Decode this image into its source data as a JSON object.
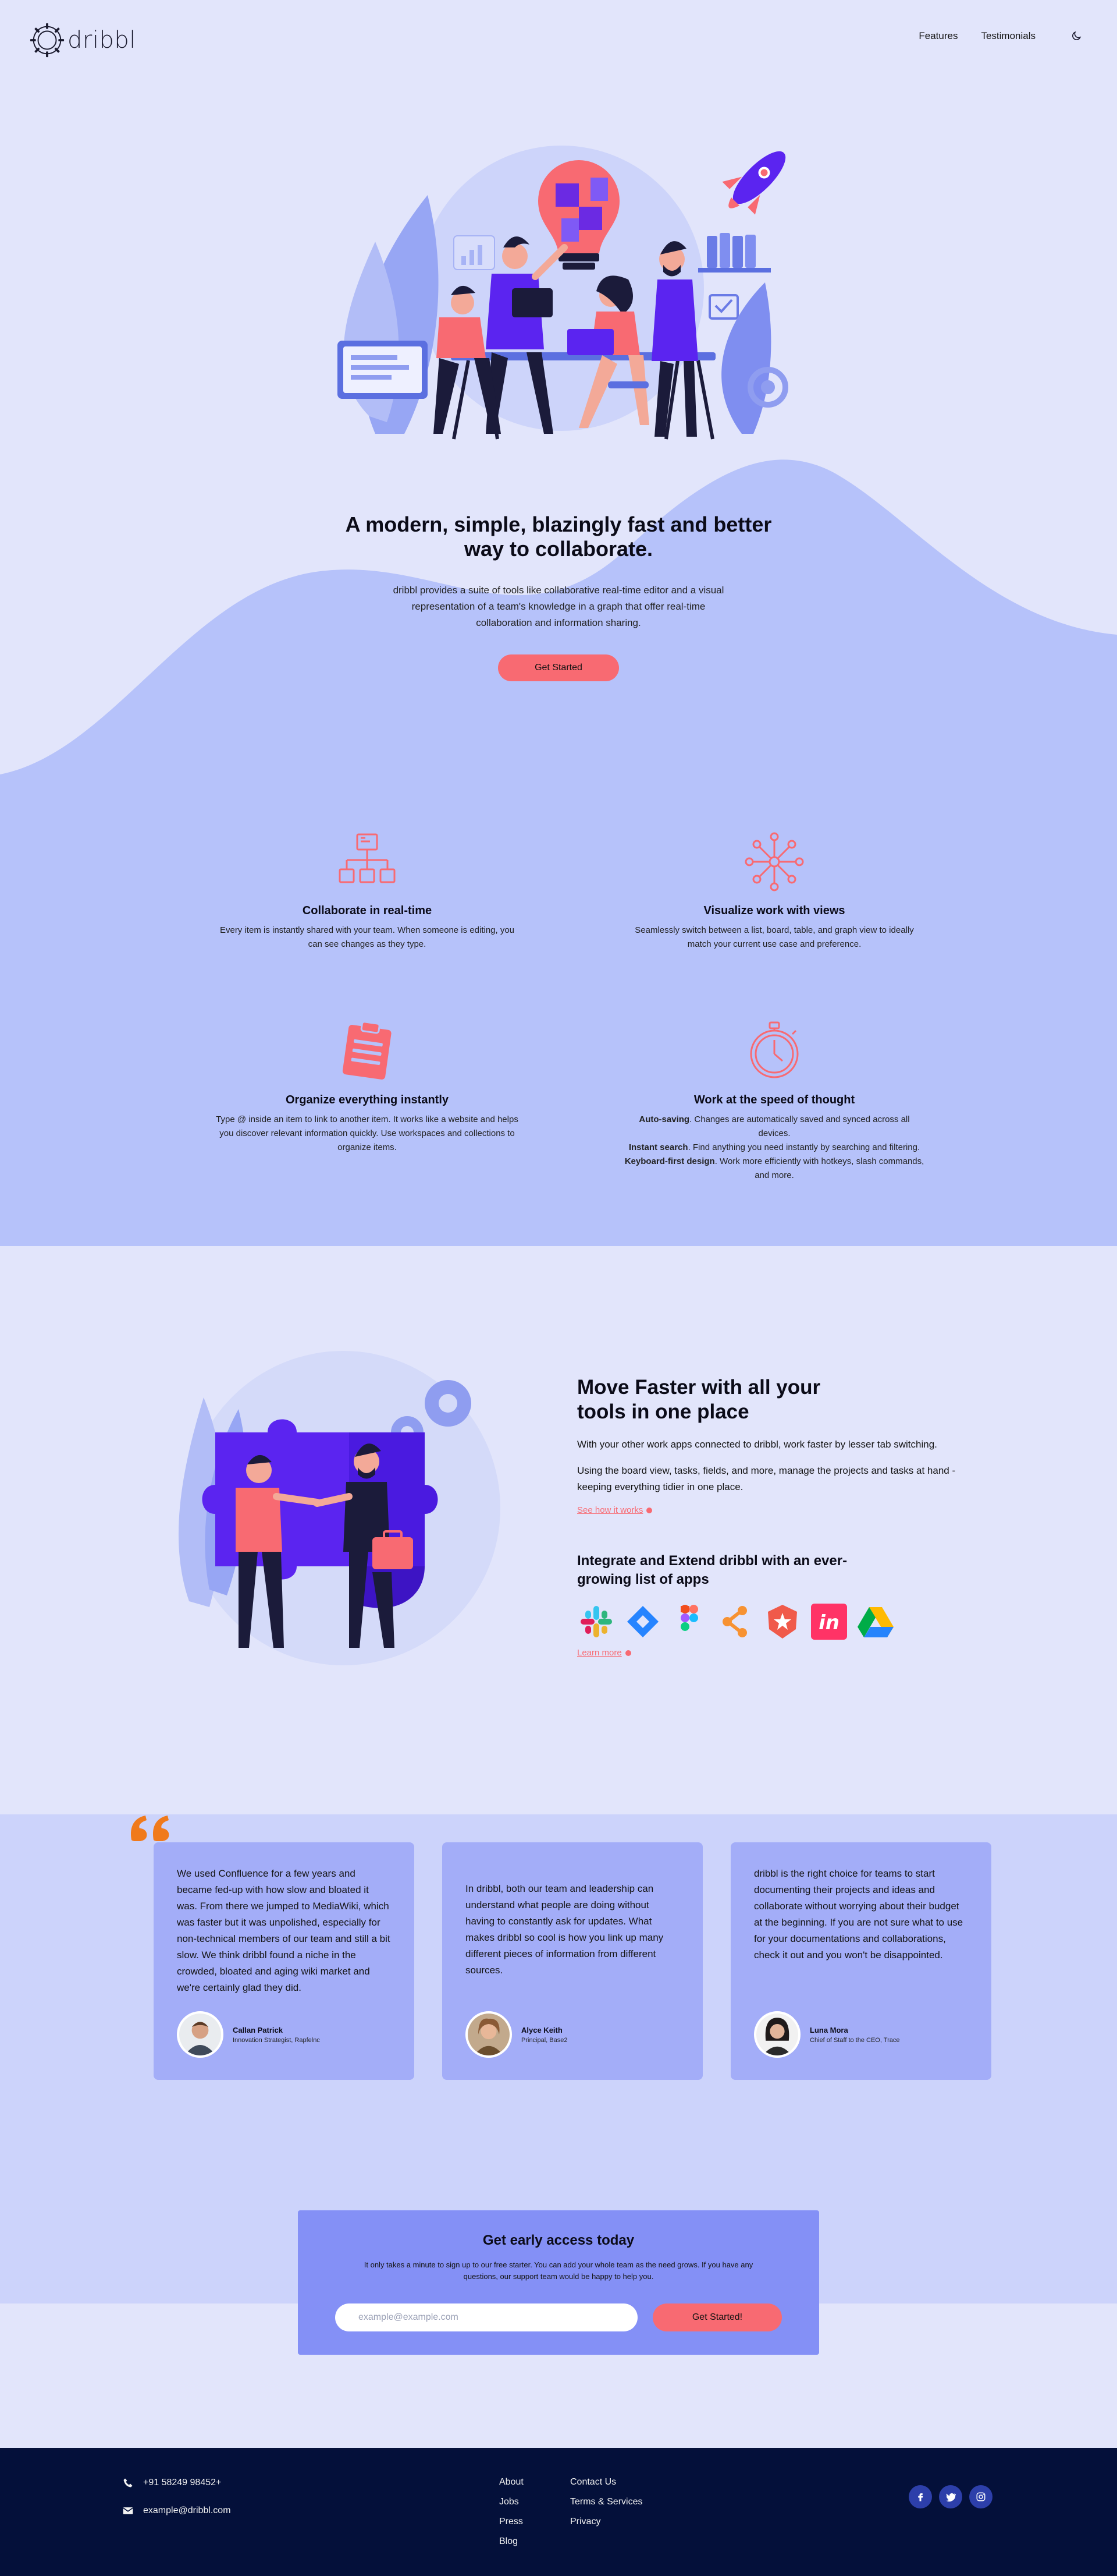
{
  "brand": {
    "name": "dribbl"
  },
  "nav": {
    "links": [
      "Features",
      "Testimonials"
    ],
    "theme_toggle_icon": "moon-icon"
  },
  "hero": {
    "title": "A modern, simple, blazingly fast and better way to collaborate.",
    "description": "dribbl provides a suite of tools like collaborative real-time editor and a visual representation of a team's knowledge in a graph that offer real-time collaboration and information sharing.",
    "cta_label": "Get Started"
  },
  "features": [
    {
      "icon": "org-chart-icon",
      "title": "Collaborate in real-time",
      "text": "Every item is instantly shared with your team. When someone is editing, you can see changes as they type."
    },
    {
      "icon": "network-graph-icon",
      "title": "Visualize work with views",
      "text": "Seamlessly switch between a list, board, table, and graph view to ideally match your current use case and preference."
    },
    {
      "icon": "clipboard-icon",
      "title": "Organize everything instantly",
      "text": "Type @ inside an item to link to another item. It works like a website and helps you discover relevant information quickly. Use workspaces and collections to organize items."
    },
    {
      "icon": "stopwatch-icon",
      "title": "Work at the speed of thought",
      "lines": [
        {
          "bold": "Auto-saving",
          "text": ". Changes are automatically saved and synced across all devices."
        },
        {
          "bold": "Instant search",
          "text": ". Find anything you need instantly by searching and filtering."
        },
        {
          "bold": "Keyboard-first design",
          "text": ". Work more efficiently with hotkeys, slash commands, and more."
        }
      ]
    }
  ],
  "move_faster": {
    "title": "Move Faster with all your tools in one place",
    "p1": "With your other work apps connected to dribbl, work faster by lesser tab switching.",
    "p2": "Using the board view, tasks, fields, and more, manage the projects and tasks at hand - keeping everything tidier in one place.",
    "link": "See how it works"
  },
  "integrations": {
    "title": "Integrate and Extend dribbl with an ever-growing list of apps",
    "apps": [
      "slack-icon",
      "jira-icon",
      "figma-icon",
      "tool-icon",
      "badge-icon",
      "invision-icon",
      "google-drive-icon"
    ],
    "link": "Learn more"
  },
  "testimonials": [
    {
      "quote": "We used Confluence for a few years and became fed-up with how slow and bloated it was. From there we jumped to MediaWiki, which was faster but it was unpolished, especially for non-technical members of our team and still a bit slow. We think dribbl found a niche in the crowded, bloated and aging wiki market and we're certainly glad they did.",
      "name": "Callan Patrick",
      "role": "Innovation Strategist, Rapfelnc"
    },
    {
      "quote": "In dribbl, both our team and leadership can understand what people are doing without having to constantly ask for updates. What makes dribbl so cool is how you link up many different pieces of information from different sources.",
      "name": "Alyce Keith",
      "role": "Principal, Base2"
    },
    {
      "quote": "dribbl is the right choice for teams to start documenting their projects and ideas and collaborate without worrying about their budget at the beginning. If you are not sure what to use for your documentations and collaborations, check it out and you won't be disappointed.",
      "name": "Luna Mora",
      "role": "Chief of Staff to the CEO, Trace"
    }
  ],
  "cta": {
    "title": "Get early access today",
    "text": "It only takes a minute to sign up to our free starter. You can add your whole team as the need grows. If you have any questions, our support team would be happy to help you.",
    "placeholder": "example@example.com",
    "button": "Get Started!"
  },
  "footer": {
    "phone": "+91 58249 98452+",
    "email": "example@dribbl.com",
    "col1": [
      "About",
      "Jobs",
      "Press",
      "Blog"
    ],
    "col2": [
      "Contact Us",
      "Terms & Services",
      "Privacy"
    ],
    "social": [
      "facebook-icon",
      "twitter-icon",
      "instagram-icon"
    ]
  },
  "colors": {
    "accent": "#f86a72",
    "primary": "#5b24f0",
    "footer_bg": "#04103a",
    "hero_bg": "#e2e5fb",
    "band": "#b6c2fa"
  }
}
